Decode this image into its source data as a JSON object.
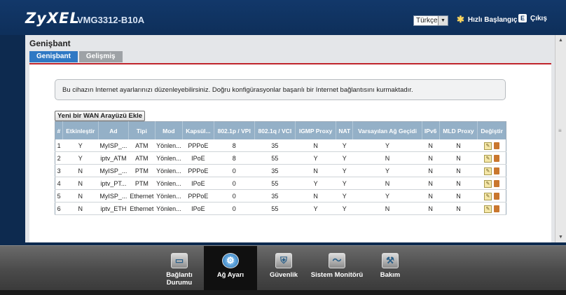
{
  "header": {
    "logo": "ZyXEL",
    "model": "VMG3312-B10A",
    "language": "Türkçe",
    "quick_start": "Hızlı Başlangıç",
    "logout": "Çıkış",
    "quick_icon": "wizard-icon",
    "logout_icon": "exit-icon"
  },
  "page": {
    "title": "Genişbant",
    "tabs": [
      {
        "label": "Genişbant",
        "active": true
      },
      {
        "label": "Gelişmiş",
        "active": false
      }
    ],
    "info": "Bu cihazın Internet ayarlarınızı düzenleyebilirsiniz. Doğru konfigürasyonlar başarılı bir Internet bağlantısını kurmaktadır.",
    "add_button": "Yeni bir WAN Arayüzü  Ekle"
  },
  "table": {
    "headers": [
      "#",
      "Etkinleştir",
      "Ad",
      "Tipi",
      "Mod",
      "Kapsül...",
      "802.1p / VPI",
      "802.1q / VCI",
      "IGMP Proxy",
      "NAT",
      "Varsayılan Ağ Geçidi",
      "IPv6",
      "MLD Proxy",
      "Değiştir"
    ],
    "rows": [
      [
        "1",
        "Y",
        "MyISP_...",
        "ATM",
        "Yönlen...",
        "PPPoE",
        "8",
        "35",
        "N",
        "Y",
        "Y",
        "N",
        "N"
      ],
      [
        "2",
        "Y",
        "iptv_ATM",
        "ATM",
        "Yönlen...",
        "IPoE",
        "8",
        "55",
        "Y",
        "Y",
        "N",
        "N",
        "N"
      ],
      [
        "3",
        "N",
        "MyISP_...",
        "PTM",
        "Yönlen...",
        "PPPoE",
        "0",
        "35",
        "N",
        "Y",
        "Y",
        "N",
        "N"
      ],
      [
        "4",
        "N",
        "iptv_PT...",
        "PTM",
        "Yönlen...",
        "IPoE",
        "0",
        "55",
        "Y",
        "Y",
        "N",
        "N",
        "N"
      ],
      [
        "5",
        "N",
        "MyISP_...",
        "Ethernet",
        "Yönlen...",
        "PPPoE",
        "0",
        "35",
        "N",
        "Y",
        "Y",
        "N",
        "N"
      ],
      [
        "6",
        "N",
        "iptv_ETH",
        "Ethernet",
        "Yönlen...",
        "IPoE",
        "0",
        "55",
        "Y",
        "Y",
        "N",
        "N",
        "N"
      ]
    ]
  },
  "nav": [
    {
      "label": "Bağlantı Durumu",
      "icon": "monitor-icon",
      "active": false
    },
    {
      "label": "Ağ Ayarı",
      "icon": "gear-icon",
      "active": true
    },
    {
      "label": "Güvenlik",
      "icon": "shield-icon",
      "active": false
    },
    {
      "label": "Sistem Monitörü",
      "icon": "chart-icon",
      "active": false
    },
    {
      "label": "Bakım",
      "icon": "tools-icon",
      "active": false
    }
  ],
  "colors": {
    "header": "#12386a",
    "tab_active": "#2f78c4",
    "panel_rule": "#c0242c",
    "table_header": "#94b0c7"
  }
}
